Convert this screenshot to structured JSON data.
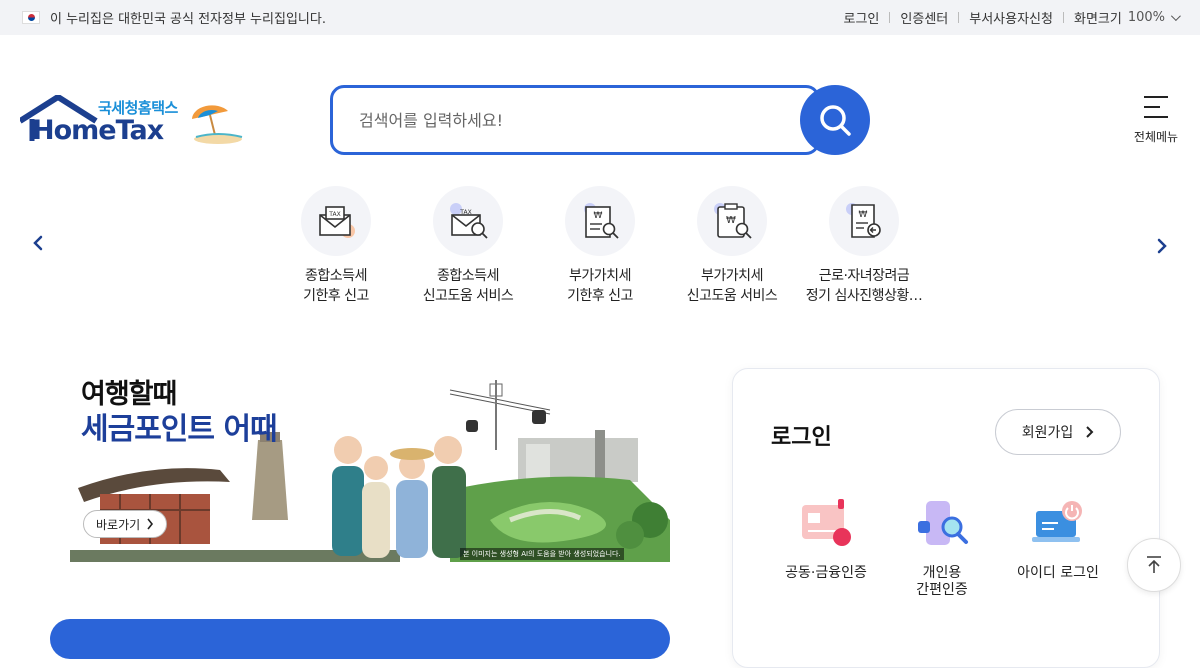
{
  "topbar": {
    "notice": "이 누리집은 대한민국 공식 전자정부 누리집입니다.",
    "links": [
      "로그인",
      "인증센터",
      "부서사용자신청"
    ],
    "zoom_label": "화면크기",
    "zoom_value": "100%"
  },
  "logo": {
    "sub": "국세청홈택스",
    "main": "HomeTax"
  },
  "search": {
    "placeholder": "검색어를 입력하세요!"
  },
  "menu": {
    "label": "전체메뉴"
  },
  "quick_menu": [
    {
      "label": "종합소득세\n기한후 신고",
      "icon": "tax-envelope-icon"
    },
    {
      "label": "종합소득세\n신고도움 서비스",
      "icon": "tax-search-icon"
    },
    {
      "label": "부가가치세\n기한후 신고",
      "icon": "vat-document-icon"
    },
    {
      "label": "부가가치세\n신고도움 서비스",
      "icon": "vat-clipboard-icon"
    },
    {
      "label": "근로·자녀장려금\n정기 심사진행상황…",
      "icon": "benefit-receipt-icon"
    }
  ],
  "banner": {
    "line1": "여행할때",
    "line2": "세금포인트 어때",
    "button": "바로가기",
    "caption": "본 이미지는 생성형 AI의 도움을 받아 생성되었습니다."
  },
  "login": {
    "title": "로그인",
    "join_button": "회원가입",
    "options": [
      {
        "label": "공동·금융인증",
        "icon": "certificate-card-icon"
      },
      {
        "label": "개인용\n간편인증",
        "icon": "phone-search-icon"
      },
      {
        "label": "아이디 로그인",
        "icon": "laptop-power-icon"
      }
    ]
  },
  "colors": {
    "primary": "#2b64d8",
    "logo_navy": "#1c3f8f",
    "logo_sky": "#1a8fd8"
  }
}
